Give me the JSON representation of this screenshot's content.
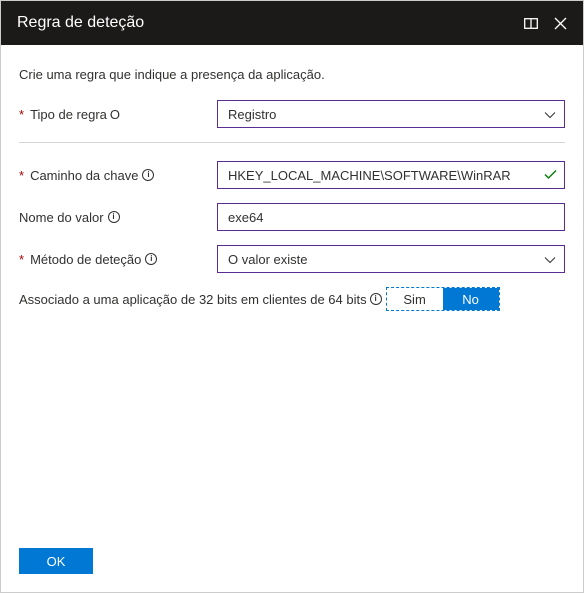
{
  "header": {
    "title": "Regra de deteção"
  },
  "description": "Crie uma regra que indique a presença da aplicação.",
  "fields": {
    "ruleType": {
      "label": "Tipo de regra",
      "labelSuffix": "O",
      "value": "Registro"
    },
    "keyPath": {
      "label": "Caminho da chave",
      "value": "HKEY_LOCAL_MACHINE\\SOFTWARE\\WinRAR"
    },
    "valueName": {
      "label": "Nome do valor",
      "value": "exe64"
    },
    "detectionMethod": {
      "label": "Método de deteção",
      "value": "O valor existe"
    }
  },
  "associated": {
    "label": "Associado a uma aplicação de 32 bits em clientes de 64 bits",
    "yes": "Sim",
    "no": "No"
  },
  "footer": {
    "ok": "OK"
  }
}
